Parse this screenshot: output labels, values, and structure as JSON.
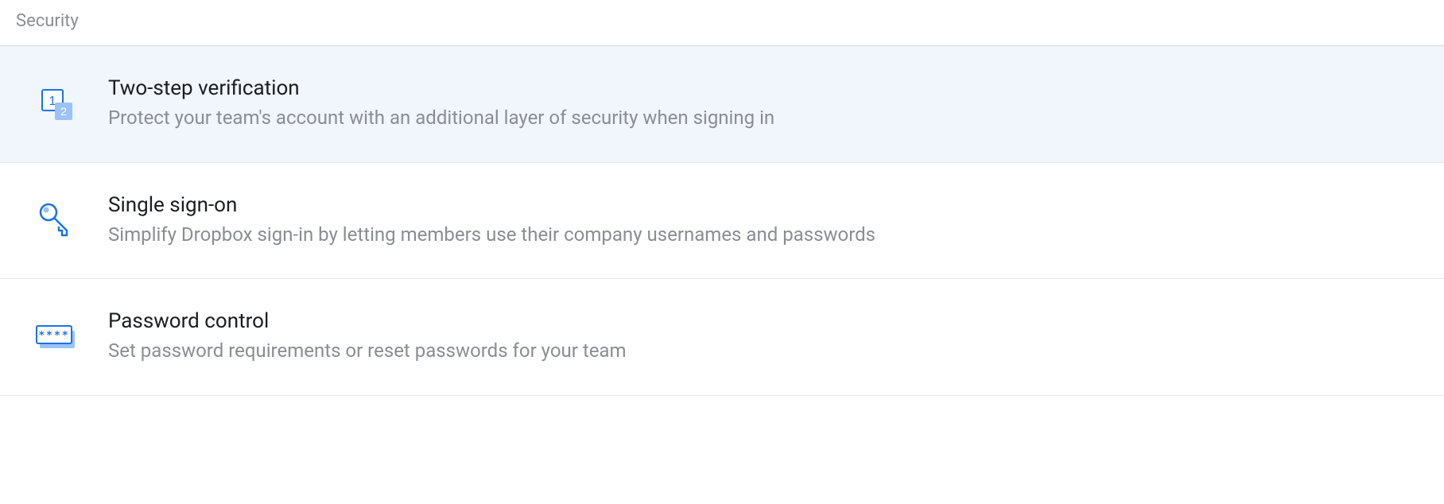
{
  "section": {
    "header": "Security",
    "items": [
      {
        "title": "Two-step verification",
        "description": "Protect your team's account with an additional layer of security when signing in"
      },
      {
        "title": "Single sign-on",
        "description": "Simplify Dropbox sign-in by letting members use their company usernames and passwords"
      },
      {
        "title": "Password control",
        "description": "Set password requirements or reset passwords for your team"
      }
    ]
  }
}
